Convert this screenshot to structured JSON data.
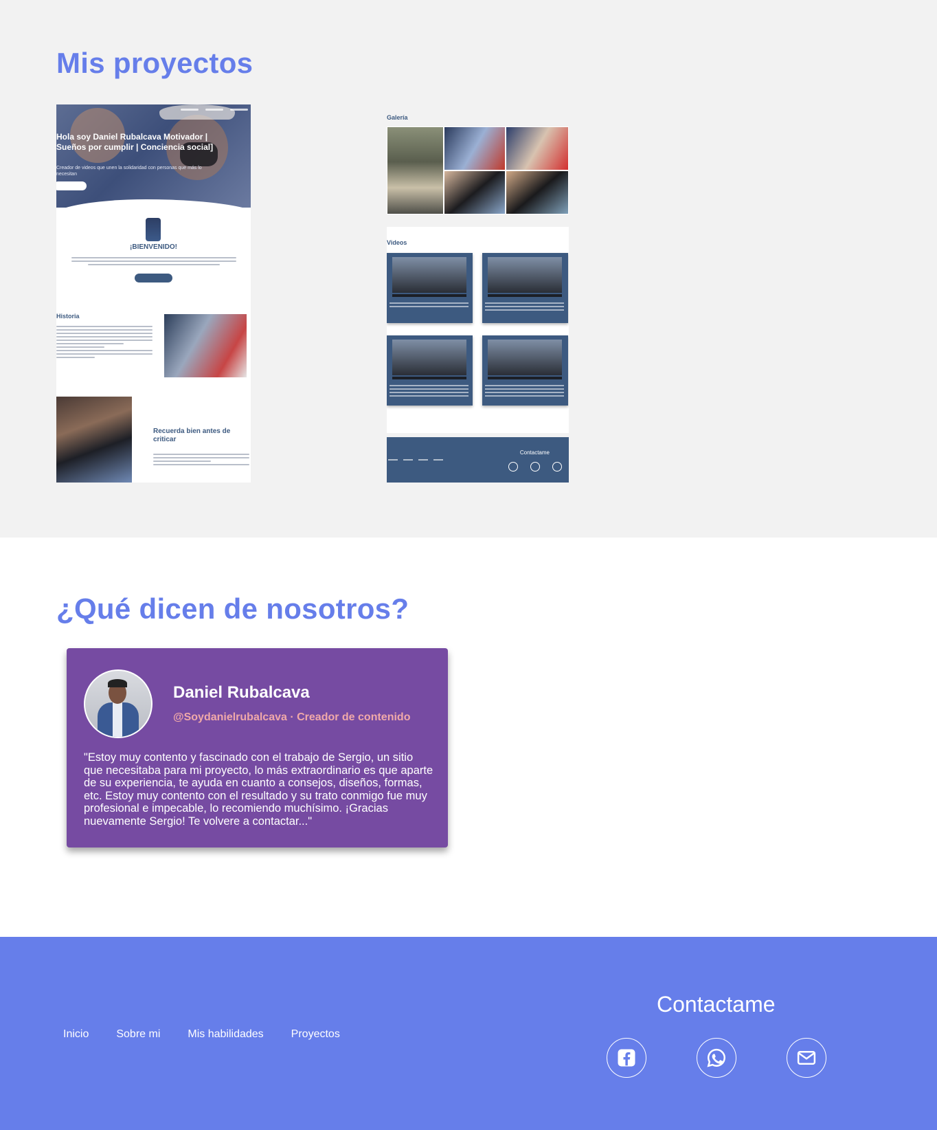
{
  "projects": {
    "title": "Mis proyectos",
    "mock1": {
      "hero_title": "Hola soy Daniel Rubalcava Motivador | Sueños por cumplir | Conciencia social]",
      "hero_subtitle": "Creador de videos que unen la solidaridad con personas que más lo necesitan",
      "welcome": "¡BIENVENIDO!",
      "historia": "Historia",
      "recuerda": "Recuerda bien antes de criticar"
    },
    "mock2": {
      "galeria": "Galería",
      "videos": "Videos",
      "contact": "Contactame"
    }
  },
  "testimonials": {
    "title": "¿Qué dicen de nosotros?",
    "card": {
      "name": "Daniel Rubalcava",
      "handle": "@Soydanielrubalcava · Creador de contenido",
      "quote": "\"Estoy muy contento y fascinado con el trabajo de Sergio, un sitio que necesitaba para mi proyecto, lo más extraordinario es que aparte de su experiencia, te ayuda en cuanto a consejos, diseños, formas, etc. Estoy muy contento con el resultado y su trato conmigo fue muy profesional e impecable, lo recomiendo muchísimo. ¡Gracias nuevamente Sergio! Te volvere a contactar...\""
    }
  },
  "footer": {
    "nav": [
      "Inicio",
      "Sobre mi",
      "Mis habilidades",
      "Proyectos"
    ],
    "contact_title": "Contactame",
    "icons": [
      "facebook-icon",
      "whatsapp-icon",
      "mail-icon"
    ]
  },
  "colors": {
    "accent": "#667eea",
    "card": "#764ba2",
    "handle": "#f0a9a9",
    "mock_primary": "#3d5a80",
    "section_bg": "#f2f2f2"
  }
}
